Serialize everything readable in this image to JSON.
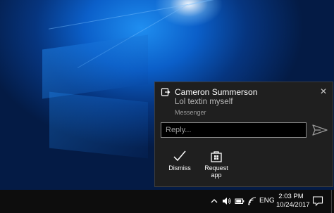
{
  "notification": {
    "title": "Cameron Summerson",
    "body": "Lol textin myself",
    "app_name": "Messenger",
    "reply_placeholder": "Reply...",
    "actions": [
      {
        "label": "Dismiss",
        "icon": "checkmark-icon"
      },
      {
        "label_line1": "Request",
        "label_line2": "app",
        "icon": "store-icon"
      }
    ]
  },
  "taskbar": {
    "language": "ENG",
    "time": "2:03 PM",
    "date": "10/24/2017",
    "tray_icons": [
      "chevron-up-icon",
      "volume-icon",
      "battery-icon",
      "wifi-icon"
    ]
  },
  "colors": {
    "toast_background": "#1f1f1f",
    "taskbar_background": "#0d0d0d",
    "desktop_blue": "#0b5fc9"
  }
}
